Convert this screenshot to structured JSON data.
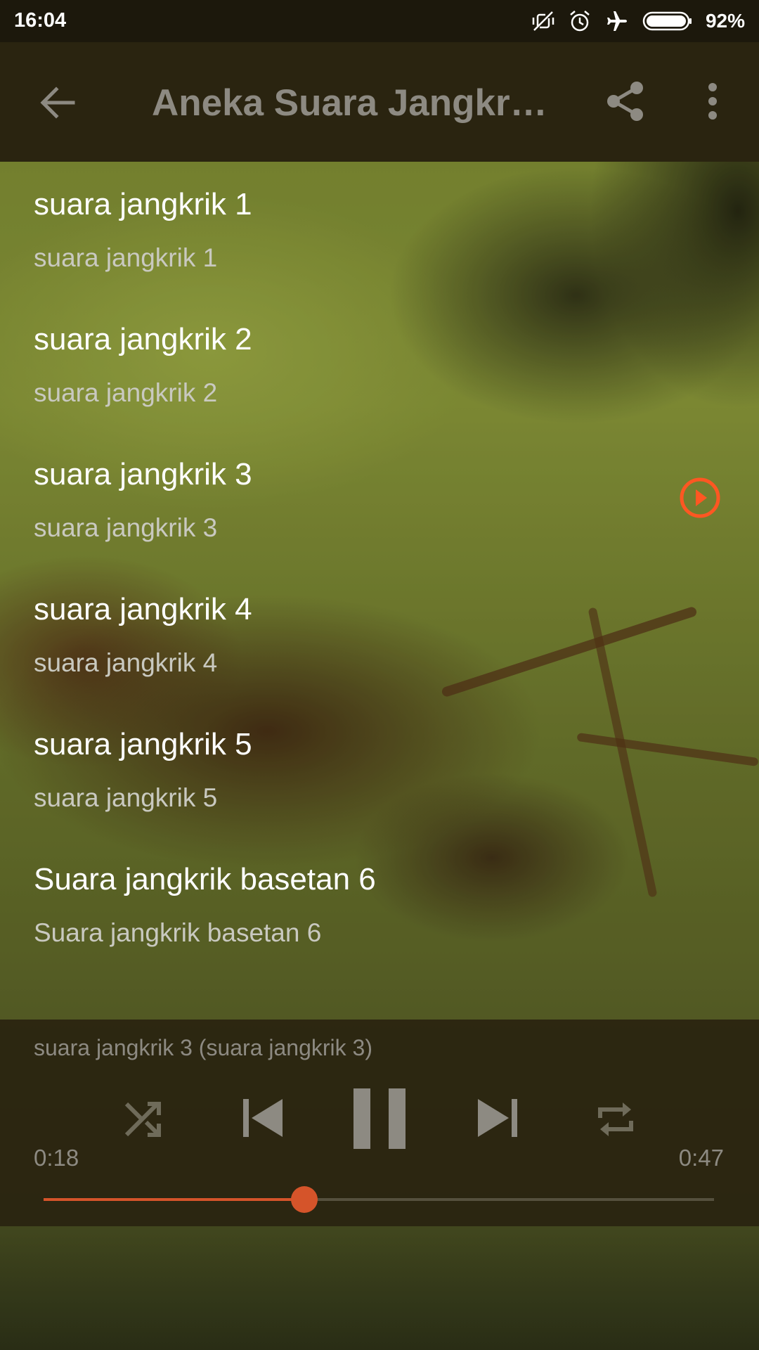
{
  "status_bar": {
    "time": "16:04",
    "battery_percent": "92%",
    "icons": [
      "vibrate-off-icon",
      "alarm-icon",
      "airplane-icon",
      "battery-icon"
    ]
  },
  "app_bar": {
    "title": "Aneka Suara Jangkr…",
    "icons": [
      "back-arrow-icon",
      "share-icon",
      "more-vert-icon"
    ]
  },
  "tracks": [
    {
      "title": "suara jangkrik 1",
      "subtitle": "suara jangkrik 1"
    },
    {
      "title": "suara jangkrik 2",
      "subtitle": "suara jangkrik 2"
    },
    {
      "title": "suara jangkrik 3",
      "subtitle": "suara jangkrik 3",
      "now_playing": true
    },
    {
      "title": "suara jangkrik 4",
      "subtitle": "suara jangkrik 4"
    },
    {
      "title": "suara jangkrik 5",
      "subtitle": "suara jangkrik 5"
    },
    {
      "title": "Suara jangkrik basetan 6",
      "subtitle": "Suara jangkrik basetan 6"
    }
  ],
  "player": {
    "now_playing": "suara jangkrik 3 (suara jangkrik 3)",
    "current_time": "0:18",
    "total_time": "0:47",
    "progress_fraction": 0.389,
    "controls": [
      "shuffle-icon",
      "skip-previous-icon",
      "pause-icon",
      "skip-next-icon",
      "repeat-icon"
    ]
  },
  "colors": {
    "accent": "#d5542a",
    "now_playing_icon": "#ff5722",
    "bar_background": "#2a2410",
    "status_bar": "#1c180c",
    "muted_text": "#8d8a82"
  }
}
